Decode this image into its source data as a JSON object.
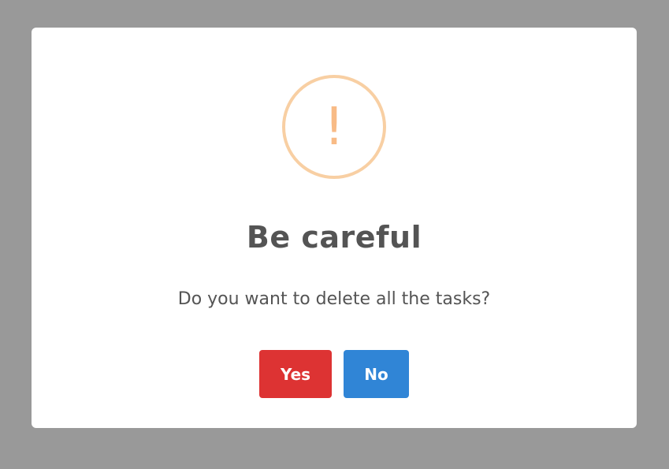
{
  "dialog": {
    "icon": "warning-exclamation-icon",
    "icon_glyph": "!",
    "icon_color": "#f8bb86",
    "title": "Be careful",
    "message": "Do you want to delete all the tasks?",
    "confirm_label": "Yes",
    "cancel_label": "No",
    "confirm_color": "#dd3333",
    "cancel_color": "#3085d6"
  }
}
